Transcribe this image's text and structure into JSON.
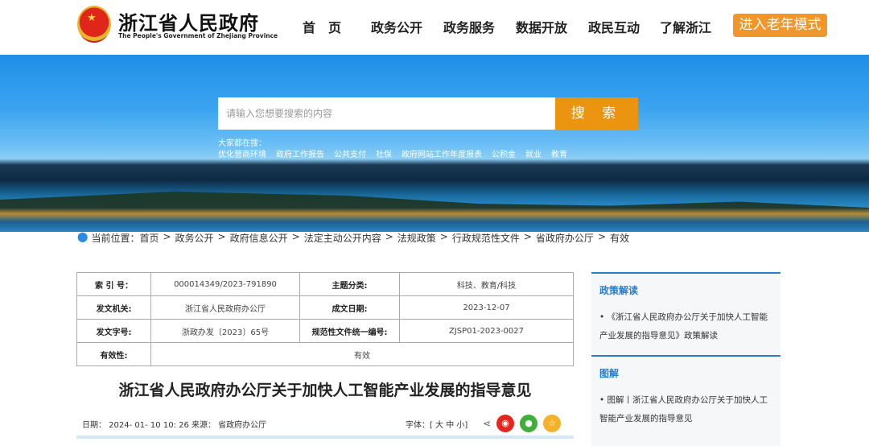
{
  "header": {
    "title": "浙江省人民政府",
    "subtitle": "The People's Government of Zhejiang Province",
    "nav": [
      "首　页",
      "政务公开",
      "政务服务",
      "数据开放",
      "政民互动",
      "了解浙江"
    ],
    "elder_mode": "进入老年模式"
  },
  "search": {
    "placeholder": "请输入您想要搜索的内容",
    "button": "搜 索",
    "hot_label": "大家都在搜：",
    "hot": [
      "优化营商环境",
      "政府工作报告",
      "公共支付",
      "社保",
      "政府网站工作年度报表",
      "公积金",
      "就业",
      "教育"
    ]
  },
  "breadcrumb": {
    "label": "当前位置：",
    "items": [
      "首页",
      "政务公开",
      "政府信息公开",
      "法定主动公开内容",
      "法规政策",
      "行政规范性文件",
      "省政府办公厅",
      "有效"
    ]
  },
  "info": {
    "index_label": "索 引 号：",
    "index": "000014349/2023-791890",
    "topic_label": "主题分类:",
    "topic": "科技、教育/科技",
    "org_label": "发文机关:",
    "org": "浙江省人民政府办公厅",
    "date_label": "成文日期:",
    "date": "2023-12-07",
    "doc_label": "发文字号:",
    "doc": "浙政办发〔2023〕65号",
    "code_label": "规范性文件统一编号:",
    "code": "ZJSP01-2023-0027",
    "valid_label": "有效性:",
    "valid": "有效"
  },
  "article": {
    "title": "浙江省人民政府办公厅关于加快人工智能产业发展的指导意见",
    "meta": "日期： 2024- 01- 10 10: 26  来源： 省政府办公厅",
    "font_size": "字体：[ 大 中 小]"
  },
  "sidebar": [
    {
      "title": "政策解读",
      "item": "• 《浙江省人民政府办公厅关于加快人工智能产业发展的指导意见》政策解读"
    },
    {
      "title": "图解",
      "item": "• 图解丨浙江省人民政府办公厅关于加快人工智能产业发展的指导意见"
    }
  ]
}
